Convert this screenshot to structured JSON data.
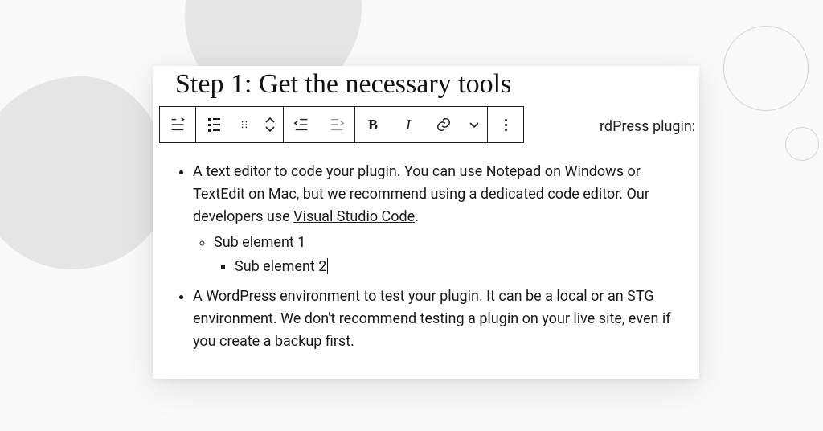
{
  "heading": "Step 1: Get the necessary tools",
  "toolbar_trail": "rdPress plugin:",
  "bullets": {
    "item1": {
      "pre": "A text editor to code your plugin. You can use Notepad on Windows or TextEdit on Mac, but we recommend using a dedicated code editor. Our developers use ",
      "link1": "Visual Studio Code",
      "post": "."
    },
    "sub1": "Sub element 1",
    "sub2": "Sub element 2",
    "item2": {
      "pre": "A WordPress environment to test your plugin. It can be a ",
      "link1": "local",
      "mid1": " or an ",
      "link2": "STG",
      "mid2": " environment. We don't recommend testing a plugin on your live site, even if you ",
      "link3": "create a backup",
      "post": " first."
    }
  }
}
